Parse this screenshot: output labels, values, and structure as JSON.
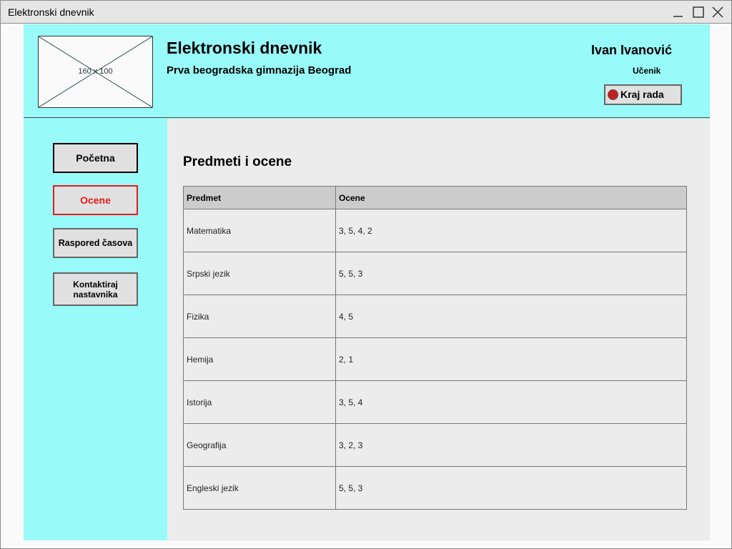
{
  "window": {
    "title": "Elektronski dnevnik"
  },
  "header": {
    "logo_placeholder": "160 x 100",
    "app_title": "Elektronski dnevnik",
    "school_name": "Prva beogradska gimnazija Beograd",
    "user_name": "Ivan Ivanović",
    "user_role": "Učenik",
    "logout_label": "Kraj rada"
  },
  "sidebar": {
    "items": [
      {
        "label": "Početna"
      },
      {
        "label": "Ocene"
      },
      {
        "label": "Raspored časova"
      },
      {
        "label": "Kontaktiraj nastavnika"
      }
    ]
  },
  "main": {
    "title": "Predmeti i ocene",
    "table": {
      "headers": [
        "Predmet",
        "Ocene"
      ],
      "rows": [
        {
          "subject": "Matematika",
          "grades": "3, 5, 4, 2"
        },
        {
          "subject": "Srpski jezik",
          "grades": "5, 5, 3"
        },
        {
          "subject": "Fizika",
          "grades": "4, 5"
        },
        {
          "subject": "Hemija",
          "grades": "2, 1"
        },
        {
          "subject": "Istorija",
          "grades": "3, 5, 4"
        },
        {
          "subject": "Geografija",
          "grades": "3, 2, 3"
        },
        {
          "subject": "Engleski jezik",
          "grades": "5, 5, 3"
        }
      ]
    }
  },
  "colors": {
    "accent_cyan": "#99fafa",
    "active_nav": "#e61919",
    "logout_dot": "#c41f1f"
  }
}
